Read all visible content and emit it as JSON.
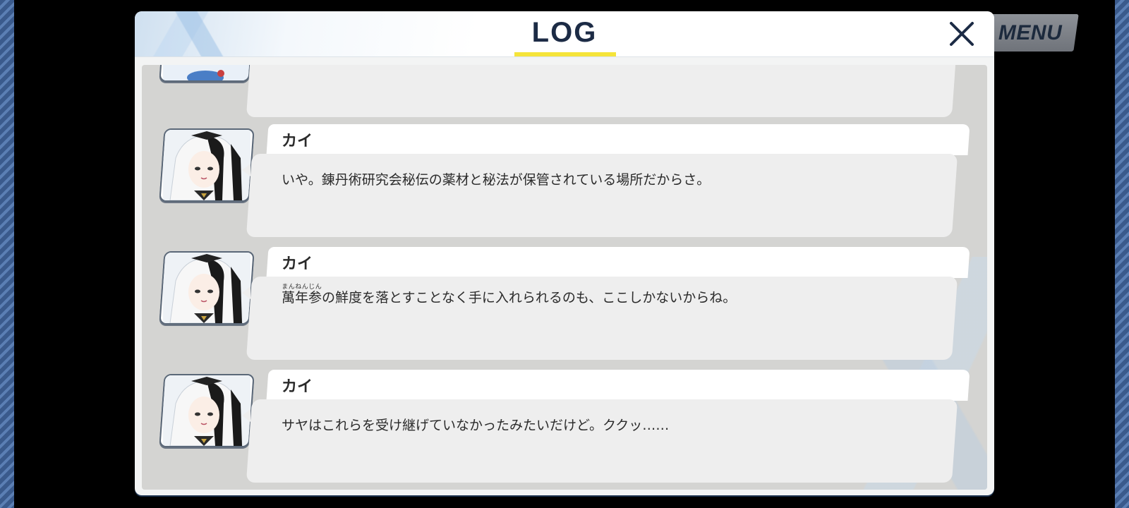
{
  "menu": {
    "label": "MENU"
  },
  "log_window": {
    "title": "LOG",
    "close_icon": "close-icon",
    "accent_color": "#f5e43a",
    "title_color": "#1c2b45"
  },
  "entries": [
    {
      "speaker": "",
      "text": ""
    },
    {
      "speaker": "カイ",
      "text": "いや。錬丹術研究会秘伝の薬材と秘法が保管されている場所だからさ。"
    },
    {
      "speaker": "カイ",
      "ruby_base": "萬年参",
      "ruby": "まんねんじん",
      "text_after": "の鮮度を落とすことなく手に入れられるのも、ここしかないからね。"
    },
    {
      "speaker": "カイ",
      "text": "サヤはこれらを受け継げていなかったみたいだけど。ククッ……"
    }
  ]
}
